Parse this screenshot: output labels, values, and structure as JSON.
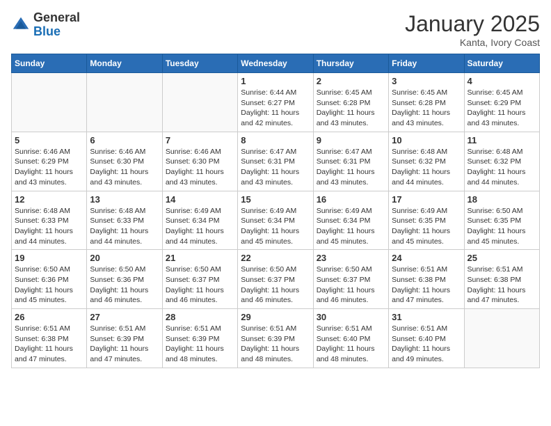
{
  "header": {
    "logo_general": "General",
    "logo_blue": "Blue",
    "month_title": "January 2025",
    "location": "Kanta, Ivory Coast"
  },
  "days_of_week": [
    "Sunday",
    "Monday",
    "Tuesday",
    "Wednesday",
    "Thursday",
    "Friday",
    "Saturday"
  ],
  "weeks": [
    [
      {
        "day": "",
        "info": ""
      },
      {
        "day": "",
        "info": ""
      },
      {
        "day": "",
        "info": ""
      },
      {
        "day": "1",
        "info": "Sunrise: 6:44 AM\nSunset: 6:27 PM\nDaylight: 11 hours and 42 minutes."
      },
      {
        "day": "2",
        "info": "Sunrise: 6:45 AM\nSunset: 6:28 PM\nDaylight: 11 hours and 43 minutes."
      },
      {
        "day": "3",
        "info": "Sunrise: 6:45 AM\nSunset: 6:28 PM\nDaylight: 11 hours and 43 minutes."
      },
      {
        "day": "4",
        "info": "Sunrise: 6:45 AM\nSunset: 6:29 PM\nDaylight: 11 hours and 43 minutes."
      }
    ],
    [
      {
        "day": "5",
        "info": "Sunrise: 6:46 AM\nSunset: 6:29 PM\nDaylight: 11 hours and 43 minutes."
      },
      {
        "day": "6",
        "info": "Sunrise: 6:46 AM\nSunset: 6:30 PM\nDaylight: 11 hours and 43 minutes."
      },
      {
        "day": "7",
        "info": "Sunrise: 6:46 AM\nSunset: 6:30 PM\nDaylight: 11 hours and 43 minutes."
      },
      {
        "day": "8",
        "info": "Sunrise: 6:47 AM\nSunset: 6:31 PM\nDaylight: 11 hours and 43 minutes."
      },
      {
        "day": "9",
        "info": "Sunrise: 6:47 AM\nSunset: 6:31 PM\nDaylight: 11 hours and 43 minutes."
      },
      {
        "day": "10",
        "info": "Sunrise: 6:48 AM\nSunset: 6:32 PM\nDaylight: 11 hours and 44 minutes."
      },
      {
        "day": "11",
        "info": "Sunrise: 6:48 AM\nSunset: 6:32 PM\nDaylight: 11 hours and 44 minutes."
      }
    ],
    [
      {
        "day": "12",
        "info": "Sunrise: 6:48 AM\nSunset: 6:33 PM\nDaylight: 11 hours and 44 minutes."
      },
      {
        "day": "13",
        "info": "Sunrise: 6:48 AM\nSunset: 6:33 PM\nDaylight: 11 hours and 44 minutes."
      },
      {
        "day": "14",
        "info": "Sunrise: 6:49 AM\nSunset: 6:34 PM\nDaylight: 11 hours and 44 minutes."
      },
      {
        "day": "15",
        "info": "Sunrise: 6:49 AM\nSunset: 6:34 PM\nDaylight: 11 hours and 45 minutes."
      },
      {
        "day": "16",
        "info": "Sunrise: 6:49 AM\nSunset: 6:34 PM\nDaylight: 11 hours and 45 minutes."
      },
      {
        "day": "17",
        "info": "Sunrise: 6:49 AM\nSunset: 6:35 PM\nDaylight: 11 hours and 45 minutes."
      },
      {
        "day": "18",
        "info": "Sunrise: 6:50 AM\nSunset: 6:35 PM\nDaylight: 11 hours and 45 minutes."
      }
    ],
    [
      {
        "day": "19",
        "info": "Sunrise: 6:50 AM\nSunset: 6:36 PM\nDaylight: 11 hours and 45 minutes."
      },
      {
        "day": "20",
        "info": "Sunrise: 6:50 AM\nSunset: 6:36 PM\nDaylight: 11 hours and 46 minutes."
      },
      {
        "day": "21",
        "info": "Sunrise: 6:50 AM\nSunset: 6:37 PM\nDaylight: 11 hours and 46 minutes."
      },
      {
        "day": "22",
        "info": "Sunrise: 6:50 AM\nSunset: 6:37 PM\nDaylight: 11 hours and 46 minutes."
      },
      {
        "day": "23",
        "info": "Sunrise: 6:50 AM\nSunset: 6:37 PM\nDaylight: 11 hours and 46 minutes."
      },
      {
        "day": "24",
        "info": "Sunrise: 6:51 AM\nSunset: 6:38 PM\nDaylight: 11 hours and 47 minutes."
      },
      {
        "day": "25",
        "info": "Sunrise: 6:51 AM\nSunset: 6:38 PM\nDaylight: 11 hours and 47 minutes."
      }
    ],
    [
      {
        "day": "26",
        "info": "Sunrise: 6:51 AM\nSunset: 6:38 PM\nDaylight: 11 hours and 47 minutes."
      },
      {
        "day": "27",
        "info": "Sunrise: 6:51 AM\nSunset: 6:39 PM\nDaylight: 11 hours and 47 minutes."
      },
      {
        "day": "28",
        "info": "Sunrise: 6:51 AM\nSunset: 6:39 PM\nDaylight: 11 hours and 48 minutes."
      },
      {
        "day": "29",
        "info": "Sunrise: 6:51 AM\nSunset: 6:39 PM\nDaylight: 11 hours and 48 minutes."
      },
      {
        "day": "30",
        "info": "Sunrise: 6:51 AM\nSunset: 6:40 PM\nDaylight: 11 hours and 48 minutes."
      },
      {
        "day": "31",
        "info": "Sunrise: 6:51 AM\nSunset: 6:40 PM\nDaylight: 11 hours and 49 minutes."
      },
      {
        "day": "",
        "info": ""
      }
    ]
  ]
}
